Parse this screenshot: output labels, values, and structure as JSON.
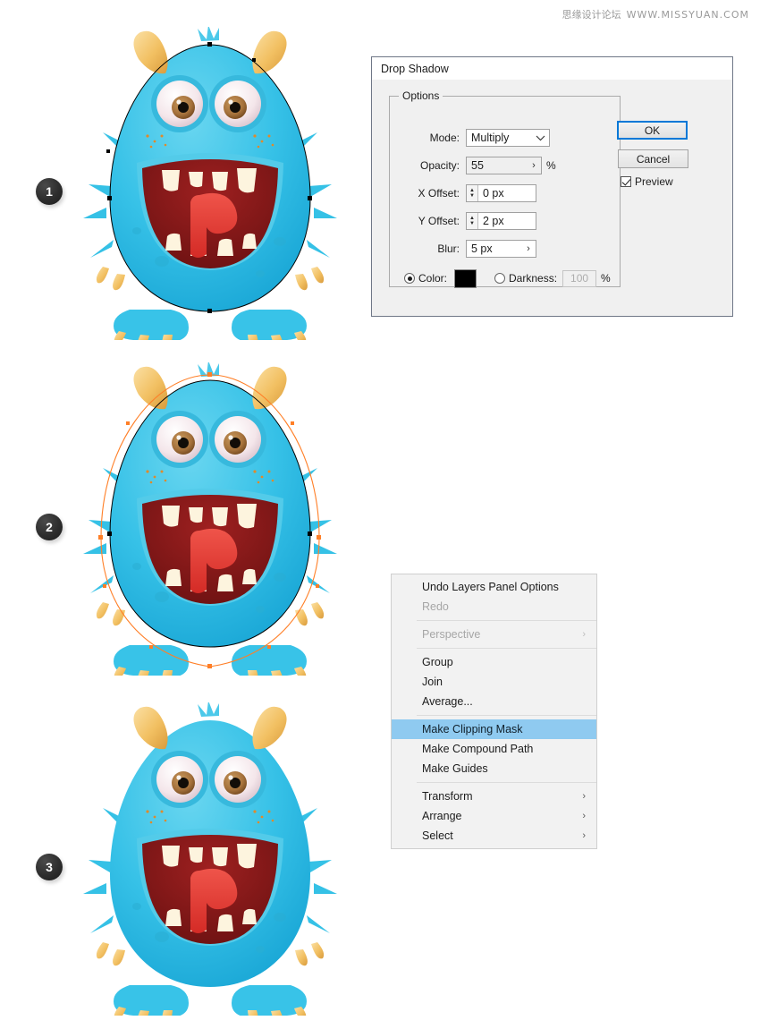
{
  "watermark": {
    "cn": "思缘设计论坛",
    "url": "WWW.MISSYUAN.COM"
  },
  "steps": [
    {
      "number": "1"
    },
    {
      "number": "2"
    },
    {
      "number": "3"
    }
  ],
  "illustration": {
    "subject": "blue furry monster character",
    "body_color": "#35c0e6",
    "body_color_dark": "#1ea9d6",
    "horn_color": "#f2c46a",
    "mouth_color": "#8e1a1a",
    "tongue_color": "#e0362f",
    "tooth_color": "#fdf4de",
    "eye_white": "#f3e4ea",
    "iris_color": "#a9753e",
    "path_color": "#000000",
    "anchor_color": "#ff7f27"
  },
  "dialog": {
    "title": "Drop Shadow",
    "group_legend": "Options",
    "fields": {
      "mode": {
        "label": "Mode:",
        "value": "Multiply",
        "control": "combobox",
        "icon": "chevron-down-icon"
      },
      "opacity": {
        "label": "Opacity:",
        "value": "55",
        "unit": "%",
        "control": "flyout",
        "icon": "chevron-right-icon"
      },
      "x_offset": {
        "label": "X Offset:",
        "value": "0 px",
        "control": "spinner",
        "icon": "spinner-arrows-icon"
      },
      "y_offset": {
        "label": "Y Offset:",
        "value": "2 px",
        "control": "spinner",
        "icon": "spinner-arrows-icon"
      },
      "blur": {
        "label": "Blur:",
        "value": "5 px",
        "control": "flyout",
        "icon": "chevron-right-icon"
      },
      "color": {
        "label": "Color:",
        "selected": true,
        "swatch": "#000000"
      },
      "darkness": {
        "label": "Darkness:",
        "selected": false,
        "value": "100",
        "unit": "%",
        "disabled": true
      }
    },
    "buttons": {
      "ok": "OK",
      "cancel": "Cancel"
    },
    "preview": {
      "label": "Preview",
      "checked": true
    }
  },
  "context_menu": {
    "items": [
      {
        "label": "Undo Layers Panel Options",
        "disabled": false,
        "highlighted": false,
        "submenu": false
      },
      {
        "label": "Redo",
        "disabled": true,
        "highlighted": false,
        "submenu": false
      },
      {
        "separator": true
      },
      {
        "label": "Perspective",
        "disabled": true,
        "highlighted": false,
        "submenu": true,
        "arrow": "›"
      },
      {
        "separator": true
      },
      {
        "label": "Group",
        "disabled": false,
        "highlighted": false,
        "submenu": false
      },
      {
        "label": "Join",
        "disabled": false,
        "highlighted": false,
        "submenu": false
      },
      {
        "label": "Average...",
        "disabled": false,
        "highlighted": false,
        "submenu": false
      },
      {
        "separator": true
      },
      {
        "label": "Make Clipping Mask",
        "disabled": false,
        "highlighted": true,
        "submenu": false
      },
      {
        "label": "Make Compound Path",
        "disabled": false,
        "highlighted": false,
        "submenu": false
      },
      {
        "label": "Make Guides",
        "disabled": false,
        "highlighted": false,
        "submenu": false
      },
      {
        "separator": true
      },
      {
        "label": "Transform",
        "disabled": false,
        "highlighted": false,
        "submenu": true,
        "arrow": "›"
      },
      {
        "label": "Arrange",
        "disabled": false,
        "highlighted": false,
        "submenu": true,
        "arrow": "›"
      },
      {
        "label": "Select",
        "disabled": false,
        "highlighted": false,
        "submenu": true,
        "arrow": "›"
      }
    ]
  },
  "colors": {
    "accent": "#0078d7",
    "menu_highlight": "#8fcaf0",
    "dialog_bg": "#f0f0f0",
    "dialog_border": "#6f7787"
  }
}
